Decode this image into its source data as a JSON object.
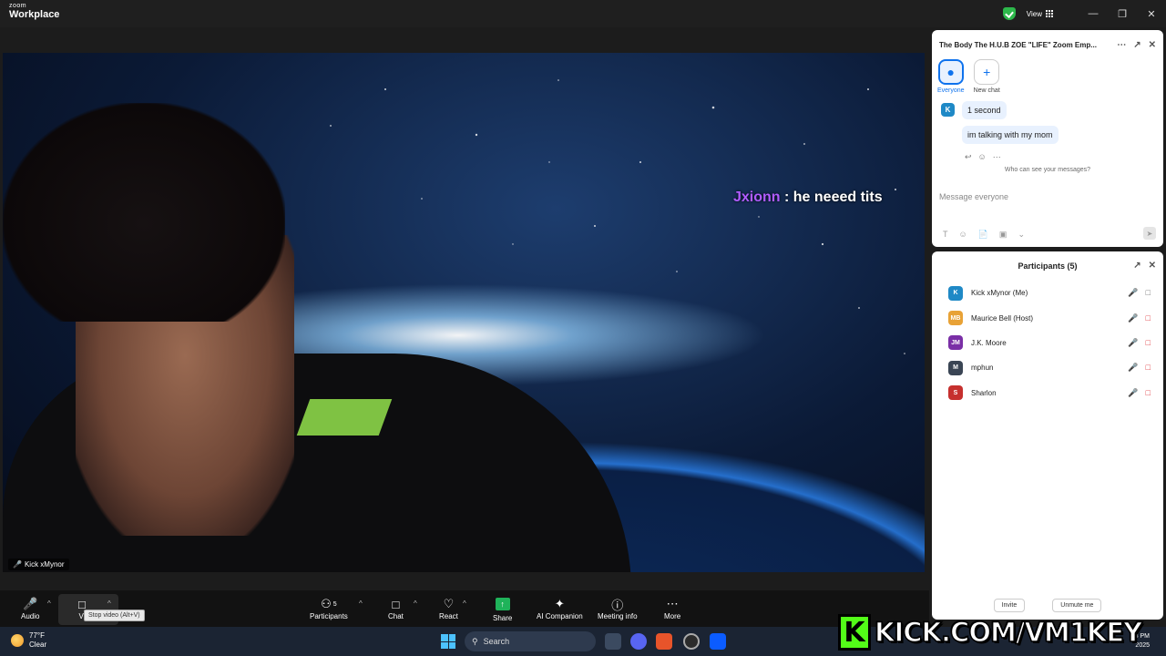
{
  "app": {
    "logo_line1": "zoom",
    "logo_line2": "Workplace",
    "view_label": "View"
  },
  "video": {
    "participant_name": "Kick xMynor",
    "overlay_user": "Jxionn",
    "overlay_sep": " : ",
    "overlay_msg": "he neeed tits"
  },
  "chat": {
    "title": "The Body The H.U.B ZOE \"LIFE\" Zoom Emp...",
    "tabs": [
      {
        "label": "Everyone"
      },
      {
        "label": "New chat"
      }
    ],
    "avatar_initial": "K",
    "messages": [
      "1 second",
      "im talking with my mom"
    ],
    "who_can_see": "Who can see your messages?",
    "compose_placeholder": "Message everyone"
  },
  "participants": {
    "title": "Participants (5)",
    "list": [
      {
        "initials": "K",
        "name": "Kick xMynor (Me)",
        "color": "#1f89c6"
      },
      {
        "initials": "MB",
        "name": "Maurice Bell (Host)",
        "color": "#e8a236"
      },
      {
        "initials": "JM",
        "name": "J.K. Moore",
        "color": "#7a2fa6"
      },
      {
        "initials": "M",
        "name": "mphun",
        "color": "#3a4554"
      },
      {
        "initials": "S",
        "name": "Sharlon",
        "color": "#c6302e"
      }
    ],
    "invite_label": "Invite",
    "unmute_me_label": "Unmute me"
  },
  "toolbar": {
    "audio": "Audio",
    "video": "Vi",
    "video_tooltip": "Stop video (Alt+V)",
    "participants": "Participants",
    "participants_count": "5",
    "chat": "Chat",
    "react": "React",
    "share": "Share",
    "ai": "AI Companion",
    "meeting_info": "Meeting info",
    "more": "More"
  },
  "taskbar": {
    "temp": "77°F",
    "condition": "Clear",
    "search": "Search",
    "time": "8 PM",
    "date": "2025"
  },
  "banner": {
    "text": "KICK.COM/VM1KEY",
    "logo_letter": "K"
  },
  "colors": {
    "accent": "#0e72ed",
    "kick_green": "#53fc18",
    "mute_red": "#e0393e",
    "share_green": "#1fb35a"
  }
}
